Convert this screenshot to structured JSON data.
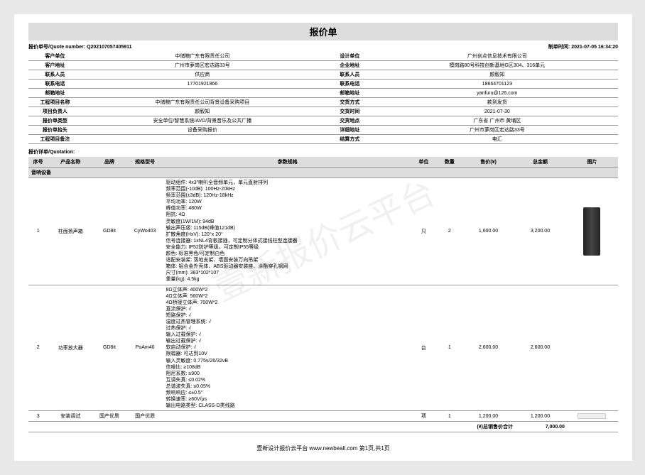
{
  "title": "报价单",
  "quote_number_label": "报价单号/Quote number:",
  "quote_number": "Q202107057405911",
  "created_label": "制单时间:",
  "created_time": "2021-07-05 16:34:20",
  "header": [
    {
      "l1": "客户单位",
      "v1": "中储粮广东有限责任公司",
      "l2": "设计单位",
      "v2": "广州创点信息技术有限公司"
    },
    {
      "l1": "客户地址",
      "v1": "广州市萝岗区宏达路33号",
      "l2": "企业地址",
      "v2": "模岗路80号科技创新基地G区304、316单元"
    },
    {
      "l1": "联系人员",
      "v1": "供应商",
      "l2": "联系人员",
      "v2": "颜毅知"
    },
    {
      "l1": "联系电话",
      "v1": "17701921866",
      "l2": "联系电话",
      "v2": "18664701123"
    },
    {
      "l1": "邮箱地址",
      "v1": "",
      "l2": "邮箱地址",
      "v2": "yanfuru@126.com"
    },
    {
      "l1": "工程项目名称",
      "v1": "中储粮广东有限责任公司背景设备采购项目",
      "l2": "交货方式",
      "v2": "款到发货"
    },
    {
      "l1": "项目负责人",
      "v1": "颜毅知",
      "l2": "交货时间",
      "v2": "2021-07-30"
    },
    {
      "l1": "报价单类型",
      "v1": "安全单位/智慧系统/AVD/背景音乐及公共广播",
      "l2": "交货地点",
      "v2": "广东省 广州市 黄埔区"
    },
    {
      "l1": "报价单抬头",
      "v1": "设备采购报价",
      "l2": "详细地址",
      "v2": "广州市萝岗区宏达路33号"
    },
    {
      "l1": "工程项目备注",
      "v1": "",
      "l2": "结算方式",
      "v2": "电汇"
    }
  ],
  "detail_title": "报价详单/Quotation:",
  "cols": {
    "seq": "序号",
    "name": "产品名称",
    "brand": "品牌",
    "model": "规格型号",
    "params": "参数规格",
    "unit": "单位",
    "qty": "数量",
    "price": "售价(¥)",
    "amount": "总金额",
    "img": "图片"
  },
  "category": "音响设备",
  "items": [
    {
      "seq": "1",
      "name": "柱面扬声箱",
      "brand": "GD8it",
      "model": "CyWo403",
      "unit": "只",
      "qty": "2",
      "price": "1,600.00",
      "amount": "3,200.00",
      "params": "驱动组件: 4x3\"喇叭全音频单元，单元直射排列\n频率范围(-10dB): 100Hz-20kHz\n频率范围(±3dB): 120Hz-18kHz\n平均功率: 120W\n峰值功率: 480W\n阻抗: 4Ω\n灵敏度(1W/1M): 94dB\n输出声压级: 115dB(峰值121dB)\n扩散角度(HxV): 120°x 20°\n信号连接器: 1xNL4背板接插，可定制分体式接线柱型连接器\n安全能力: IP52防护等级，可定制IP55等级\n颜色: 标准黑色/可定制白色\n适配安装架: 落地支架、墙面安装万向吊架\n箱体: 铝合金外壳体、ABS驱动器安装座、涂酯穿孔钢网\n尺寸(mm): 383*102*107\n重量(kg): 4.5kg"
    },
    {
      "seq": "2",
      "name": "功率放大器",
      "brand": "GD8it",
      "model": "PoAm40",
      "unit": "台",
      "qty": "1",
      "price": "2,600.00",
      "amount": "2,600.00",
      "params": "8Ω立体声: 400W*2\n4Ω立体声: 560W*2\n4Ω桥接立体声: 700W*2\n直流保护: √\n短路保护: √\n温度过热管理系统: √\n过热保护: √\n输入过载保护: √\n输出过载保护: √\n软启动保护: √\n限幅器: 可达到10V\n输入灵敏度: 0.775v/26/32vB\n信噪比: ≥108dB\n阻尼系数: ≥900\n互调失真: ≤0.02%\n总谐波失真: ≤0.05%\n频响响应: ≤±0.5°\n转换速率: ≥60V/μs\n输出电路类型: CLASS-D类线路"
    },
    {
      "seq": "3",
      "name": "安装调试",
      "brand": "国产优质",
      "model": "国产优质",
      "unit": "项",
      "qty": "1",
      "price": "1,200.00",
      "amount": "1,200.00",
      "params": ""
    }
  ],
  "total_label": "(¥)总销售价合计",
  "total_value": "7,000.00",
  "watermark": "壹新报价云平台",
  "footer": "壹新设计报价云平台 www.newbeall.com 第1页,共1页"
}
